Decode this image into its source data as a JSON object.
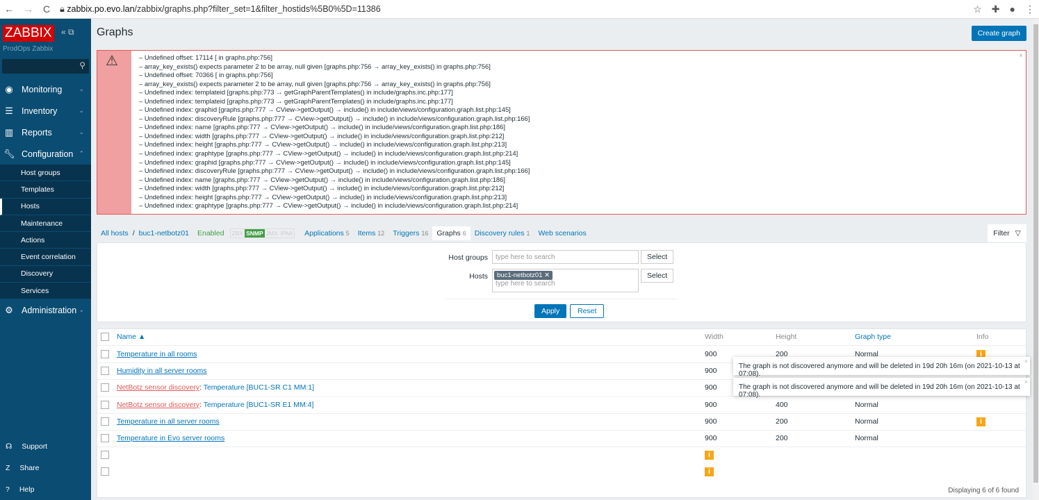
{
  "browser": {
    "url_host": "zabbix.po.evo.lan",
    "url_path": "/zabbix/graphs.php?filter_set=1&filter_hostids%5B0%5D=11386"
  },
  "sidebar": {
    "logo": "ZABBIX",
    "server": "ProdOps Zabbix",
    "menu": [
      {
        "label": "Monitoring",
        "icon": "eye"
      },
      {
        "label": "Inventory",
        "icon": "list"
      },
      {
        "label": "Reports",
        "icon": "bar-chart"
      },
      {
        "label": "Configuration",
        "icon": "wrench"
      }
    ],
    "submenu": [
      "Host groups",
      "Templates",
      "Hosts",
      "Maintenance",
      "Actions",
      "Event correlation",
      "Discovery",
      "Services"
    ],
    "admin": "Administration",
    "bottom": [
      "Support",
      "Share",
      "Help"
    ]
  },
  "page": {
    "title": "Graphs",
    "create": "Create graph"
  },
  "errors": [
    "– Undefined offset: 17114 [ in graphs.php:756]",
    "– array_key_exists() expects parameter 2 to be array, null given [graphs.php:756 → array_key_exists() in graphs.php:756]",
    "– Undefined offset: 70366 [ in graphs.php:756]",
    "– array_key_exists() expects parameter 2 to be array, null given [graphs.php:756 → array_key_exists() in graphs.php:756]",
    "– Undefined index: templateid [graphs.php:773 → getGraphParentTemplates() in include/graphs.inc.php:177]",
    "– Undefined index: templateid [graphs.php:773 → getGraphParentTemplates() in include/graphs.inc.php:177]",
    "– Undefined index: graphid [graphs.php:777 → CView->getOutput() → include() in include/views/configuration.graph.list.php:145]",
    "– Undefined index: discoveryRule [graphs.php:777 → CView->getOutput() → include() in include/views/configuration.graph.list.php:166]",
    "– Undefined index: name [graphs.php:777 → CView->getOutput() → include() in include/views/configuration.graph.list.php:186]",
    "– Undefined index: width [graphs.php:777 → CView->getOutput() → include() in include/views/configuration.graph.list.php:212]",
    "– Undefined index: height [graphs.php:777 → CView->getOutput() → include() in include/views/configuration.graph.list.php:213]",
    "– Undefined index: graphtype [graphs.php:777 → CView->getOutput() → include() in include/views/configuration.graph.list.php:214]",
    "– Undefined index: graphid [graphs.php:777 → CView->getOutput() → include() in include/views/configuration.graph.list.php:145]",
    "– Undefined index: discoveryRule [graphs.php:777 → CView->getOutput() → include() in include/views/configuration.graph.list.php:166]",
    "– Undefined index: name [graphs.php:777 → CView->getOutput() → include() in include/views/configuration.graph.list.php:186]",
    "– Undefined index: width [graphs.php:777 → CView->getOutput() → include() in include/views/configuration.graph.list.php:212]",
    "– Undefined index: height [graphs.php:777 → CView->getOutput() → include() in include/views/configuration.graph.list.php:213]",
    "– Undefined index: graphtype [graphs.php:777 → CView->getOutput() → include() in include/views/configuration.graph.list.php:214]"
  ],
  "nav": {
    "all_hosts": "All hosts",
    "sep": "/",
    "host": "buc1-netbotz01",
    "status": "Enabled",
    "avail": [
      "ZBX",
      "SNMP",
      "JMX",
      "IPMI"
    ],
    "tabs": [
      {
        "label": "Applications",
        "count": "5"
      },
      {
        "label": "Items",
        "count": "12"
      },
      {
        "label": "Triggers",
        "count": "16"
      },
      {
        "label": "Graphs",
        "count": "6"
      },
      {
        "label": "Discovery rules",
        "count": "1"
      },
      {
        "label": "Web scenarios",
        "count": ""
      }
    ],
    "filter": "Filter"
  },
  "filter": {
    "host_groups_label": "Host groups",
    "hosts_label": "Hosts",
    "placeholder": "type here to search",
    "select": "Select",
    "host_tag": "buc1-netbotz01",
    "apply": "Apply",
    "reset": "Reset"
  },
  "table": {
    "headers": {
      "name": "Name ▲",
      "width": "Width",
      "height": "Height",
      "type": "Graph type",
      "info": "Info"
    },
    "rows": [
      {
        "prefix": "",
        "name": "Temperature in all rooms",
        "width": "900",
        "height": "200",
        "type": "Normal",
        "info": "i"
      },
      {
        "prefix": "",
        "name": "Humidity in all server rooms",
        "width": "900",
        "height": "",
        "type": "",
        "info": ""
      },
      {
        "prefix": "NetBotz sensor discovery",
        "name": "Temperature [BUC1-SR C1 MM:1]",
        "width": "900",
        "height": "",
        "type": "",
        "info": ""
      },
      {
        "prefix": "NetBotz sensor discovery",
        "name": "Temperature [BUC1-SR E1 MM:4]",
        "width": "900",
        "height": "400",
        "type": "Normal",
        "info": ""
      },
      {
        "prefix": "",
        "name": "Temperature in all server rooms",
        "width": "900",
        "height": "200",
        "type": "Normal",
        "info": "i"
      },
      {
        "prefix": "",
        "name": "Temperature in Evo server rooms",
        "width": "900",
        "height": "200",
        "type": "Normal",
        "info": ""
      },
      {
        "prefix": "",
        "name": "",
        "width": "",
        "height": "",
        "type": "",
        "info": "",
        "info_mid": "i"
      },
      {
        "prefix": "",
        "name": "",
        "width": "",
        "height": "",
        "type": "",
        "info": "",
        "info_mid": "i"
      }
    ],
    "footer": "Displaying 6 of 6 found"
  },
  "tooltips": [
    "The graph is not discovered anymore and will be deleted in 19d 20h 16m (on 2021-10-13 at 07:08).",
    "The graph is not discovered anymore and will be deleted in 19d 20h 16m (on 2021-10-13 at 07:08)."
  ]
}
